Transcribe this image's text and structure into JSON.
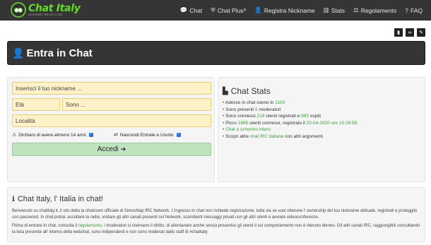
{
  "header": {
    "logo_name": "Chat Italy",
    "logo_sub": "INTERNET RELAY CHAT",
    "nav": [
      {
        "icon": "comment-icon",
        "glyph": "💬",
        "label": "Chat"
      },
      {
        "icon": "shield-icon",
        "glyph": "⛨",
        "label": "Chat Plus",
        "sup": "®"
      },
      {
        "icon": "user-plus-icon",
        "glyph": "👤",
        "label": "Registra Nickname"
      },
      {
        "icon": "bar-chart-icon",
        "glyph": "▥",
        "label": "Stats"
      },
      {
        "icon": "gavel-icon",
        "glyph": "⚖",
        "label": "Regolamento"
      },
      {
        "icon": "question-icon",
        "glyph": "?",
        "label": "FAQ"
      }
    ]
  },
  "tools": [
    {
      "icon": "bookmark-icon",
      "glyph": "▮"
    },
    {
      "icon": "link-icon",
      "glyph": "∞"
    },
    {
      "icon": "edit-icon",
      "glyph": "✎"
    }
  ],
  "banner": {
    "icon": "user-icon",
    "glyph": "👤",
    "title": "Entra in Chat"
  },
  "form": {
    "nickname_placeholder": "Inserisci il tuo nickname ...",
    "eta_placeholder": "Età",
    "sono_placeholder": "Sono ...",
    "localita_placeholder": "Località",
    "age_check_icon": "warning-icon",
    "age_check_label": "Dichiaro di avere almeno 14 anni:",
    "hide_check_icon": "exchange-icon",
    "hide_check_label": "Nascondi Entrate e Uscite:",
    "submit_label": "Accedi",
    "submit_icon": "sign-in-icon"
  },
  "stats": {
    "title": "Chat Stats",
    "icon": "area-chart-icon",
    "items": [
      {
        "pre": "Adesso in chat siamo in ",
        "v1": "1103",
        "mid": "",
        "v2": "",
        "post": ""
      },
      {
        "pre": "Sono presenti ",
        "v1": "5",
        "mid": " moderatori",
        "v2": "",
        "post": ""
      },
      {
        "pre": "Sono connessi ",
        "v1": "218",
        "mid": " utenti registrati e ",
        "v2": "883",
        "post": " ospiti"
      },
      {
        "pre": "Picco ",
        "v1": "1895",
        "mid": " utenti connessi, registrato il ",
        "v2": "20-04-2020 ore 15:26:58",
        "post": ""
      },
      {
        "pre": "",
        "v1": "Chat a schermo intero",
        "mid": "",
        "v2": "",
        "post": ""
      },
      {
        "pre": "Scopri altre ",
        "v1": "chat IRC italiane",
        "mid": " con altri argomenti",
        "v2": "",
        "post": ""
      }
    ]
  },
  "about": {
    "title": "Chat Italy, l' Italia in chat!",
    "icon": "info-circle-icon",
    "para1": "Benvenuto su chatitaly.it, il sito della la chatroom ufficiale di SimosNap IRC Network. L'ingresso in chat non richiede registrazione, tutta via se vuoi ottenere l' ownership del tuo nickname abituale, registrati e proteggilo con password. In chat potrai, ascoltare la radio, visitare gli altri canali presenti sul Network, scambiarti messaggi privati con gli altri utenti e avviare videoconferenze.",
    "para2_pre": "Prima di entrare in chat, consulta il ",
    "para2_link": "regolamento",
    "para2_post": ", i moderatori si riservano il diritto, di allontanare anche senza preavviso gli utenti il cui comportamento non è ritenuto ideneo. Gli altri canali IRC, raggiungibili consultando la lista presente all' interno della webchat, sono indipendenti e non sono moderati dallo staff di #chatitaly."
  }
}
